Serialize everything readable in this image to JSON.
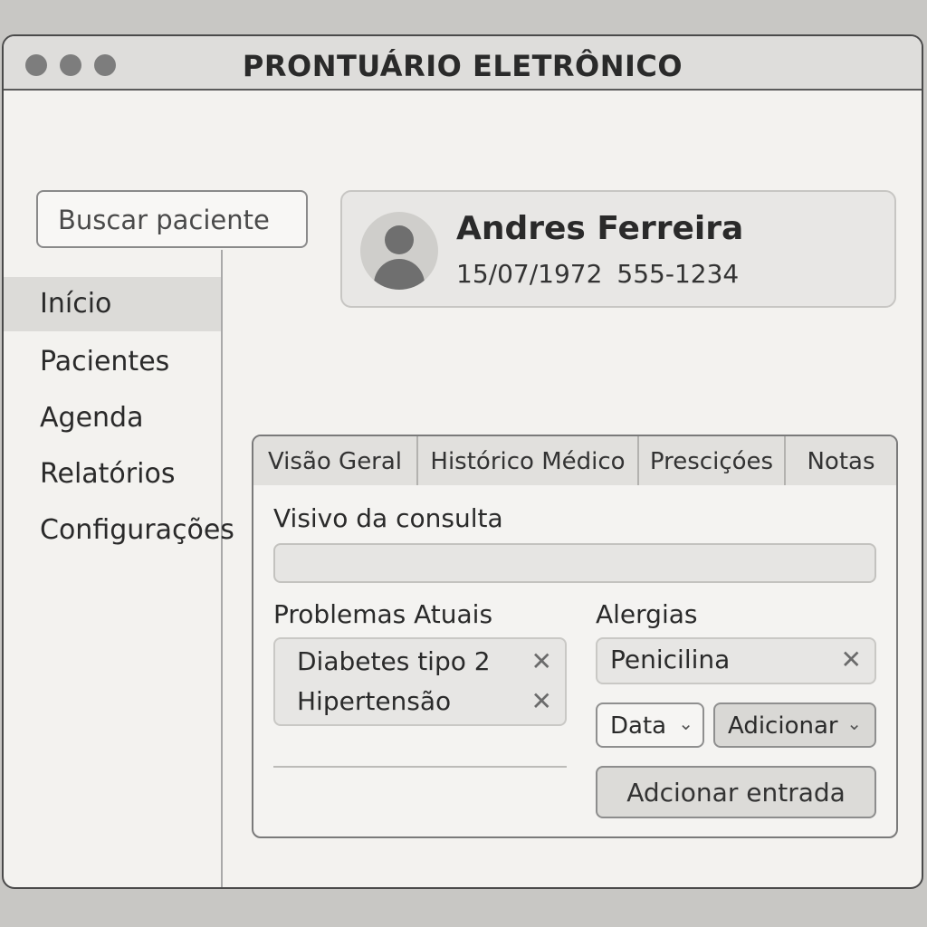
{
  "window": {
    "title": "PRONTUÁRIO ELETRÔNICO"
  },
  "search": {
    "placeholder": "Buscar paciente"
  },
  "sidebar": {
    "items": [
      {
        "label": "Início",
        "active": true
      },
      {
        "label": "Pacientes",
        "active": false
      },
      {
        "label": "Agenda",
        "active": false
      },
      {
        "label": "Relatórios",
        "active": false
      },
      {
        "label": "Configurações",
        "active": false
      }
    ]
  },
  "patient": {
    "name": "Andres Ferreira",
    "birth_date": "15/07/1972",
    "phone": "555-1234",
    "avatar_icon": "user-avatar-icon"
  },
  "tabs": [
    {
      "label": "Visão Geral",
      "active": true
    },
    {
      "label": "Histórico Médico",
      "active": false
    },
    {
      "label": "Presciçóes",
      "active": false
    },
    {
      "label": "Notas",
      "active": false
    }
  ],
  "overview": {
    "visit_reason_label": "Visivo da consulta",
    "visit_reason_value": "",
    "problems_label": "Problemas Atuais",
    "problems": [
      "Diabetes tipo 2",
      "Hipertensão"
    ],
    "allergies_label": "Alergias",
    "allergies": [
      "Penicilina"
    ],
    "date_select": "Data",
    "add_select": "Adicionar",
    "add_entry_button": "Adcionar entrada"
  },
  "icons": {
    "remove": "✕",
    "chevron": "⌄"
  },
  "colors": {
    "window_bg": "#f3f2ef",
    "titlebar_bg": "#dedddb",
    "active_item_bg": "#dcdbd8",
    "text": "#2a2a2a"
  }
}
